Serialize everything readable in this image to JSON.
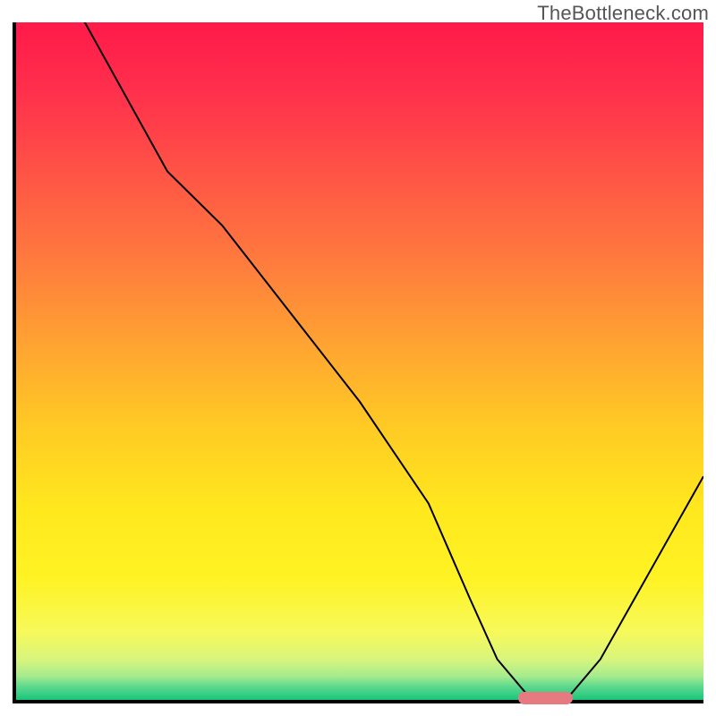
{
  "watermark": "TheBottleneck.com",
  "plot": {
    "inner_width": 768,
    "inner_height": 757
  },
  "chart_data": {
    "type": "line",
    "title": "",
    "xlabel": "",
    "ylabel": "",
    "xlim": [
      0,
      100
    ],
    "ylim": [
      0,
      100
    ],
    "x": [
      0,
      10,
      22,
      30,
      40,
      50,
      60,
      66,
      70,
      75,
      80,
      85,
      90,
      100
    ],
    "values": [
      110,
      100,
      78,
      70,
      57,
      44,
      29,
      15,
      6,
      0,
      0,
      6,
      15,
      33
    ],
    "marker": {
      "x_start": 73,
      "x_end": 81,
      "y": 0,
      "thickness_pct": 1.8
    },
    "gradient_stops": [
      {
        "pct": 0,
        "color": "#ff1a4a"
      },
      {
        "pct": 10,
        "color": "#ff2f4c"
      },
      {
        "pct": 22,
        "color": "#ff5346"
      },
      {
        "pct": 35,
        "color": "#ff7a3e"
      },
      {
        "pct": 48,
        "color": "#ffa531"
      },
      {
        "pct": 60,
        "color": "#ffcb24"
      },
      {
        "pct": 72,
        "color": "#ffe81e"
      },
      {
        "pct": 82,
        "color": "#fff324"
      },
      {
        "pct": 90,
        "color": "#f6f95a"
      },
      {
        "pct": 94,
        "color": "#d8f57c"
      },
      {
        "pct": 96.5,
        "color": "#a6eb8e"
      },
      {
        "pct": 98,
        "color": "#5fd98f"
      },
      {
        "pct": 100,
        "color": "#19c57b"
      }
    ]
  }
}
